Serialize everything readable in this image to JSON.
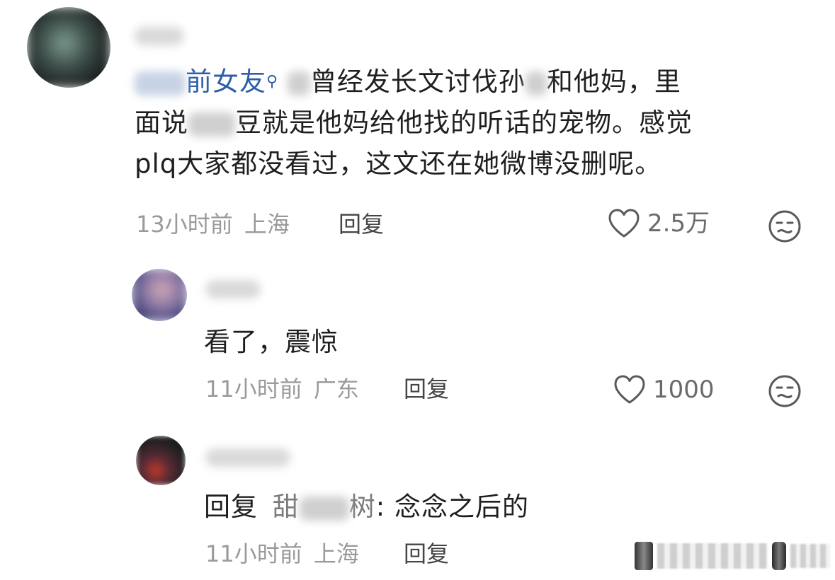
{
  "comments": [
    {
      "mention": "前女友",
      "line1_a": "曾经发长文讨伐孙",
      "line1_b": "和他妈，里",
      "line2_a": "面说",
      "line2_b": "豆就是他妈给他找的听话的宠物。感觉",
      "line3": "plq大家都没看过，这文还在她微博没删呢。",
      "time": "13小时前",
      "location": "上海",
      "reply_label": "回复",
      "likes": "2.5万"
    },
    {
      "text": "看了，震惊",
      "time": "11小时前",
      "location": "广东",
      "reply_label": "回复",
      "likes": "1000"
    },
    {
      "reply_prefix": "回复",
      "reply_target_a": "甜",
      "reply_target_b": "树",
      "reply_text": ": 念念之后的",
      "time": "11小时前",
      "location": "上海",
      "reply_label": "回复"
    }
  ],
  "colors": {
    "mention": "#2e5ea9",
    "meta": "#9a9a9a",
    "text": "#1f1f1f"
  },
  "icons": [
    "heart-icon",
    "emoji-face-icon"
  ]
}
